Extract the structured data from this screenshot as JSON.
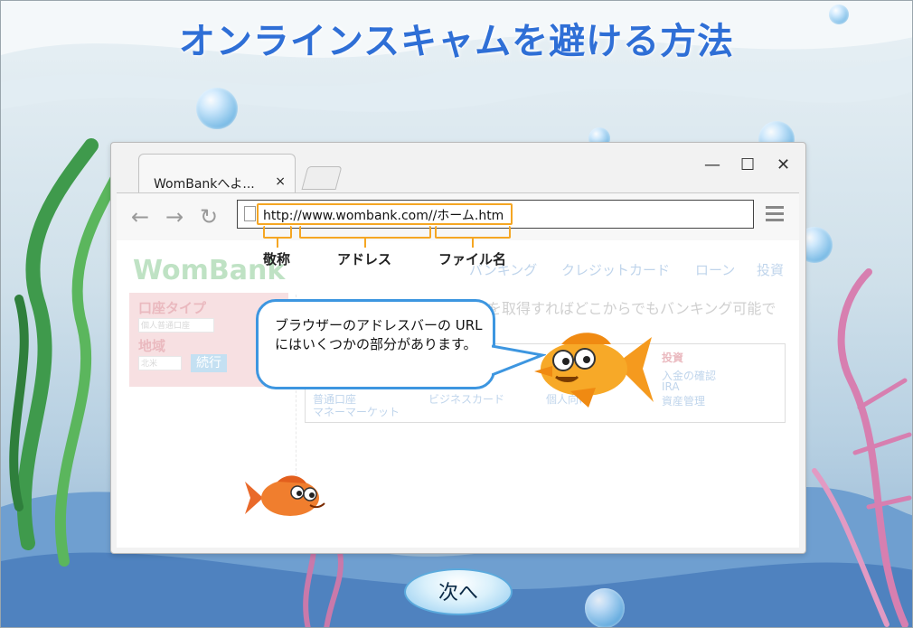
{
  "title": "オンラインスキャムを避ける方法",
  "browser": {
    "tab_title": "WomBankへよ...",
    "tab_close": "×",
    "window_controls": {
      "minimize": "—",
      "maximize": "☐",
      "close": "✕"
    },
    "nav": {
      "back": "←",
      "forward": "→",
      "reload": "↻"
    },
    "address_url": "http://www.wombank.com//ホーム.htm"
  },
  "url_parts": {
    "protocol_label": "敬称",
    "address_label": "アドレス",
    "file_label": "ファイル名"
  },
  "site": {
    "logo": "WomBank",
    "nav_items": [
      "バンキング",
      "クレジットカード",
      "ローン",
      "投資"
    ],
    "promo_text": "を取得すればどこからでもバンキング可能で",
    "account_type_label": "口座タイプ",
    "account_type_value": "個人普通口座",
    "region_label": "地域",
    "region_value": "北米",
    "go_button": "続行",
    "invest_heading": "投資",
    "invest_links": [
      "入金の確認",
      "IRA",
      "資産管理"
    ],
    "box_items": [
      "普通口座",
      "マネーマーケット",
      "ビジネスカード",
      "個人向け"
    ]
  },
  "speech_bubble": "ブラウザーのアドレスバーの URL にはいくつかの部分があります。",
  "next_button": "次へ"
}
